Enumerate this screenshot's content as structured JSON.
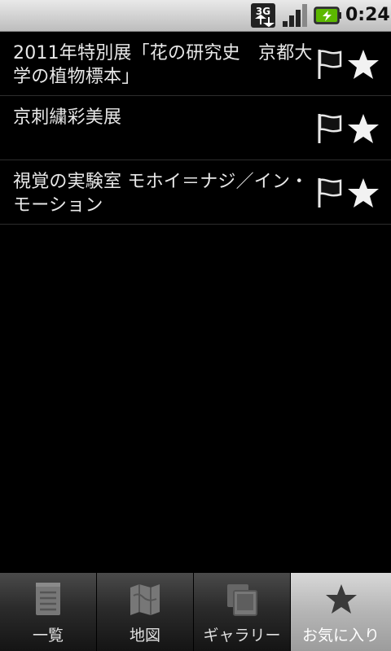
{
  "status_bar": {
    "network_label": "3G",
    "time": "0:24",
    "icons": [
      "3g-data-icon",
      "signal-strength-icon",
      "battery-charging-icon"
    ]
  },
  "list": {
    "items": [
      {
        "title": "2011年特別展「花の研究史　京都大学の植物標本」"
      },
      {
        "title": "京刺繍彩美展"
      },
      {
        "title": "視覚の実験室 モホイ＝ナジ／イン・モーション"
      }
    ]
  },
  "tabs": [
    {
      "label": "一覧",
      "icon": "list-icon",
      "selected": false
    },
    {
      "label": "地図",
      "icon": "map-icon",
      "selected": false
    },
    {
      "label": "ギャラリー",
      "icon": "gallery-icon",
      "selected": false
    },
    {
      "label": "お気に入り",
      "icon": "star-icon",
      "selected": true
    }
  ],
  "colors": {
    "background": "#000000",
    "text": "#e8e8e8",
    "status_bar": "#d4d4d4",
    "tab_selected": "#b5b5b5",
    "tab_normal": "#2b2b2b"
  }
}
